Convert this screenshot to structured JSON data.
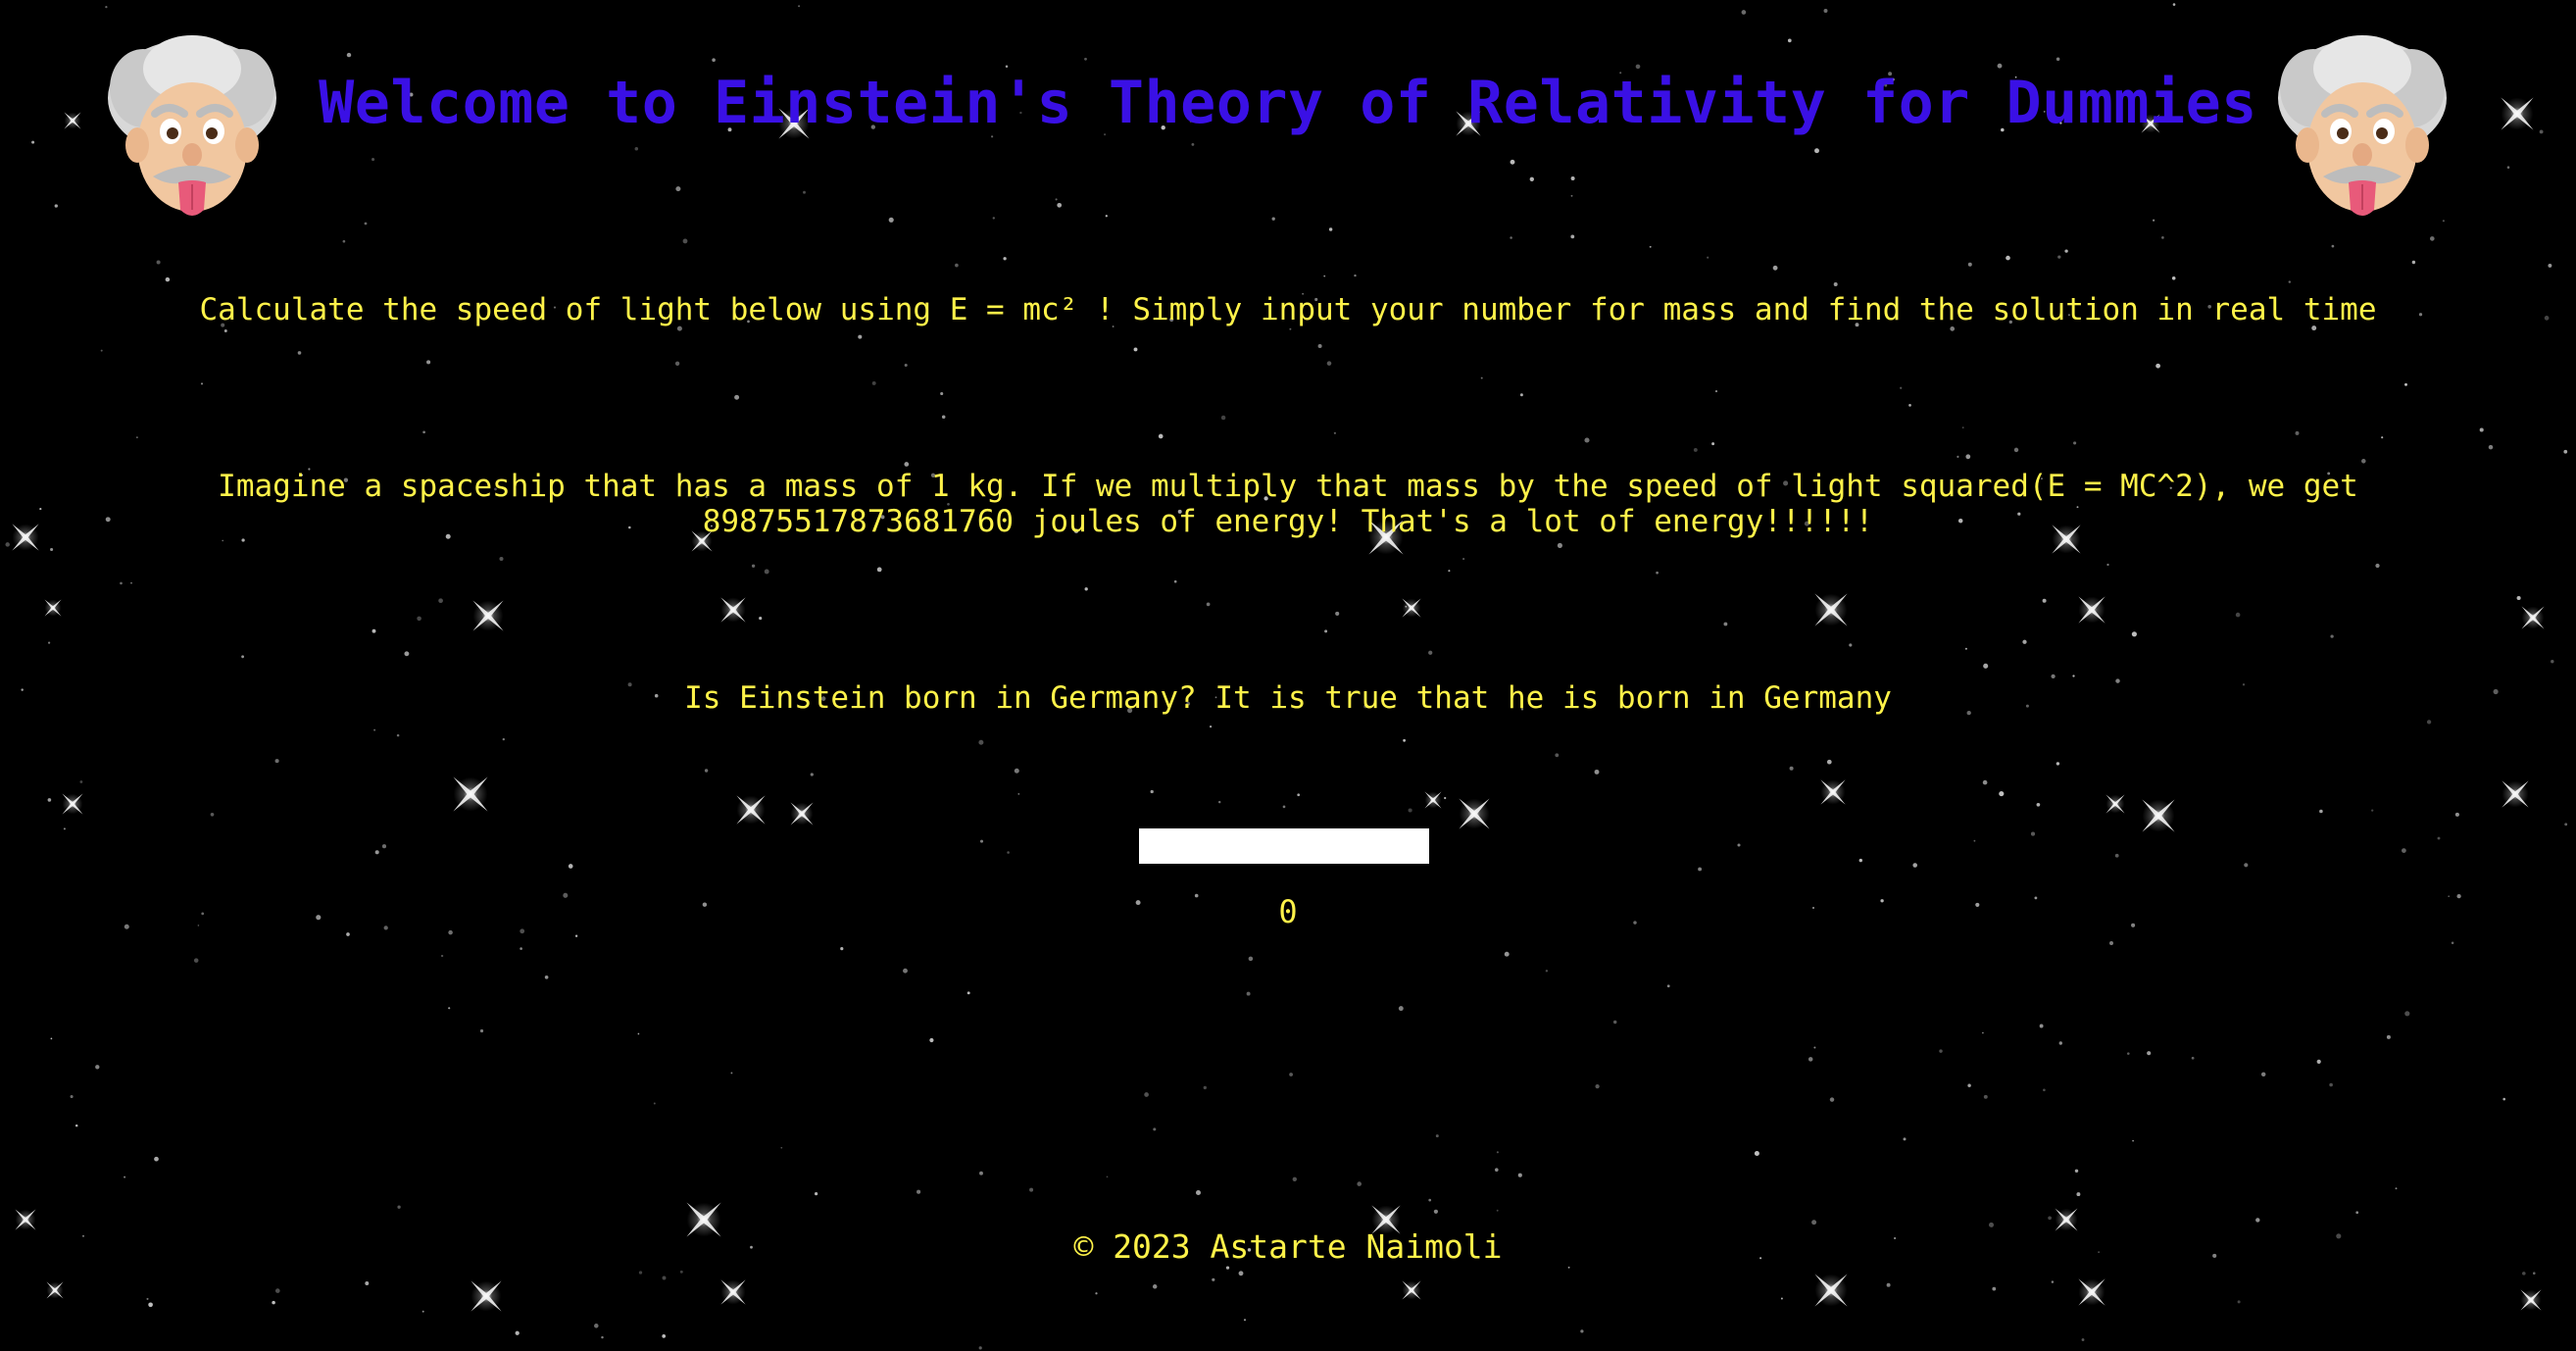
{
  "header": {
    "title": "Welcome to Einstein's Theory of Relativity for Dummies",
    "title_color": "#3a10e5"
  },
  "intro": {
    "calc_text": "Calculate the speed of light below using E = mc² ! Simply input your number for mass and find the solution in real time"
  },
  "facts": {
    "spaceship_text": "Imagine a spaceship that has a mass of 1 kg. If we multiply that mass by the speed of light squared(E = MC^2), we get 89875517873681760 joules of energy! That's a lot of energy!!!!!!",
    "born_text": "Is Einstein born in Germany? It is true that he is born in Germany"
  },
  "calculator": {
    "mass_value": "",
    "mass_placeholder": "",
    "result": "0"
  },
  "footer": {
    "copyright": "© 2023 Astarte Naimoli"
  },
  "theme": {
    "background": "#000000",
    "text_color": "#fff249",
    "accent": "#3a10e5"
  },
  "icons": {
    "left_portrait": "einstein-portrait-icon",
    "right_portrait": "einstein-portrait-icon"
  }
}
